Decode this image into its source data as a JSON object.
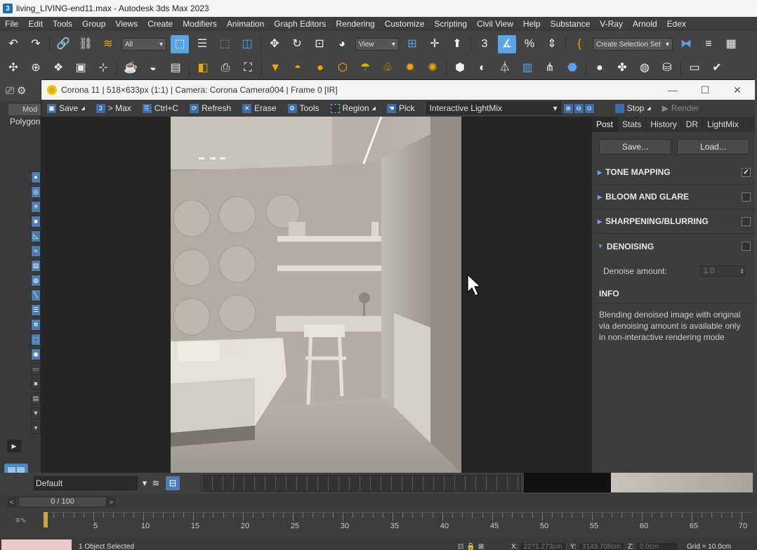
{
  "window": {
    "title": "living_LIVING-end11.max - Autodesk 3ds Max 2023",
    "icon_text": "3"
  },
  "menu": [
    "File",
    "Edit",
    "Tools",
    "Group",
    "Views",
    "Create",
    "Modifiers",
    "Animation",
    "Graph Editors",
    "Rendering",
    "Customize",
    "Scripting",
    "Civil View",
    "Help",
    "Substance",
    "V-Ray",
    "Arnold",
    "Edex"
  ],
  "toolbar1": {
    "filter_value": "All",
    "view_value": "View",
    "selection_set_placeholder": "Create Selection Set",
    "snap_label": "3"
  },
  "leftpanel": {
    "tab_label": "Mod",
    "polygon_label": "Polygon"
  },
  "vfb": {
    "title": "Corona 11 | 518×633px (1:1) | Camera: Corona Camera004 | Frame 0 [IR]",
    "toolbar": {
      "save": "Save",
      "to_max": "> Max",
      "copy": "Ctrl+C",
      "refresh": "Refresh",
      "erase": "Erase",
      "tools": "Tools",
      "region": "Region",
      "pick": "Pick",
      "lightmix": "Interactive LightMix",
      "stop": "Stop",
      "render": "Render"
    },
    "tabs": [
      "Post",
      "Stats",
      "History",
      "DR",
      "LightMix"
    ],
    "active_tab": "Post",
    "buttons": {
      "save": "Save...",
      "load": "Load..."
    },
    "sections": [
      {
        "label": "TONE MAPPING",
        "checked": true,
        "check": "✓"
      },
      {
        "label": "BLOOM AND GLARE",
        "checked": false,
        "check": ""
      },
      {
        "label": "SHARPENING/BLURRING",
        "checked": false,
        "check": ""
      },
      {
        "label": "DENOISING",
        "checked": false,
        "expanded": true,
        "check": ""
      }
    ],
    "denoise": {
      "label": "Denoise amount:",
      "value": "1.0"
    },
    "info": {
      "heading": "INFO",
      "text": "Blending denoised image with original via denoising amount is available only in non-interactive rendering mode"
    }
  },
  "layer": {
    "value": "Default"
  },
  "time": {
    "slider": "0 / 100",
    "ticks": [
      "5",
      "10",
      "15",
      "20",
      "25",
      "30",
      "35",
      "40",
      "45",
      "50",
      "55",
      "60",
      "65",
      "70"
    ]
  },
  "status": {
    "selection": "1 Object Selected",
    "x_label": "X:",
    "x_value": "2271.273cm",
    "y_label": "Y:",
    "y_value": "3149.708cm",
    "z_label": "Z:",
    "z_value": "0.0cm",
    "grid": "Grid = 10.0cm"
  },
  "colors": {
    "accent": "#5aa5e6",
    "panel": "#3d3d3d",
    "toolbar": "#444444",
    "smiley": "#f2c500"
  }
}
